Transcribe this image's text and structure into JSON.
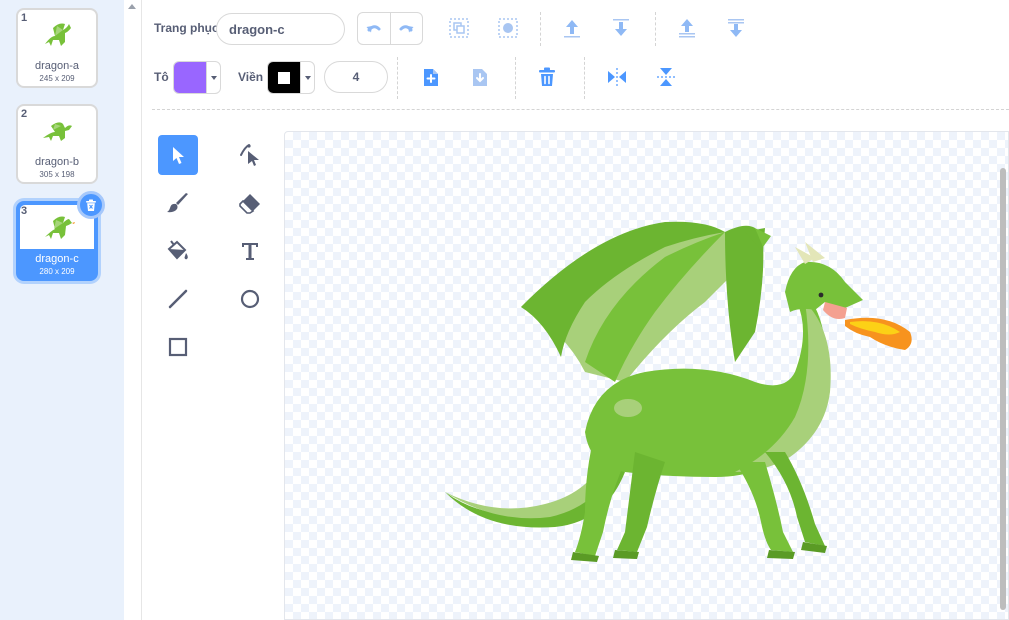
{
  "costumes": [
    {
      "number": "1",
      "name": "dragon-a",
      "size": "245 x 209"
    },
    {
      "number": "2",
      "name": "dragon-b",
      "size": "305 x 198"
    },
    {
      "number": "3",
      "name": "dragon-c",
      "size": "280 x 209"
    }
  ],
  "toolbar": {
    "costume_label": "Trang phục",
    "costume_name": "dragon-c",
    "fill_label": "Tô",
    "fill_color": "#9966ff",
    "outline_label": "Viền",
    "outline_color": "#000000",
    "outline_width": "4"
  },
  "colors": {
    "accent": "#4c97ff",
    "pane": "#e9f1fc",
    "icon": "#575e75",
    "dragon_green": "#78c13a"
  },
  "icons": [
    "undo-icon",
    "redo-icon",
    "group-icon",
    "ungroup-icon",
    "forward-icon",
    "backward-icon",
    "front-icon",
    "back-icon",
    "copy-icon",
    "paste-icon",
    "delete-icon",
    "flip-horizontal-icon",
    "flip-vertical-icon",
    "select-icon",
    "reshape-icon",
    "brush-icon",
    "eraser-icon",
    "fill-icon",
    "text-icon",
    "line-icon",
    "circle-icon",
    "rectangle-icon"
  ]
}
